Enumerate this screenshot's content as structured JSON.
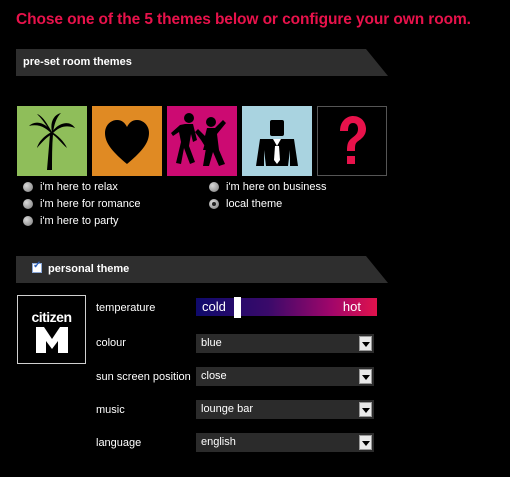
{
  "headline": "Chose one of the 5 themes below or configure your own room.",
  "preset_section": {
    "title": "pre-set room themes",
    "tiles": [
      {
        "name": "relax",
        "icon": "palm-tree-icon",
        "color": "#8fbe5a"
      },
      {
        "name": "romance",
        "icon": "heart-icon",
        "color": "#e08a23"
      },
      {
        "name": "party",
        "icon": "dancing-couple-icon",
        "color": "#cc0a72"
      },
      {
        "name": "business",
        "icon": "businessman-icon",
        "color": "#a9d3e0"
      },
      {
        "name": "local",
        "icon": "question-mark-icon",
        "color": "#000000"
      }
    ],
    "options": [
      {
        "label": "i'm here to relax",
        "checked": false
      },
      {
        "label": "i'm here for romance",
        "checked": false
      },
      {
        "label": "i'm here to party",
        "checked": false
      },
      {
        "label": "i'm here on business",
        "checked": false
      },
      {
        "label": "local theme",
        "checked": true
      }
    ]
  },
  "personal_section": {
    "title": "personal theme",
    "checked": true,
    "logo_text": "citizen",
    "temperature": {
      "label": "temperature",
      "cold_label": "cold",
      "hot_label": "hot",
      "value": 0.22
    },
    "fields": [
      {
        "label": "colour",
        "value": "blue"
      },
      {
        "label": "sun screen position",
        "value": "close"
      },
      {
        "label": "music",
        "value": "lounge bar"
      },
      {
        "label": "language",
        "value": "english"
      }
    ]
  },
  "colors": {
    "accent": "#e8124b",
    "bar": "#2e2e2e"
  }
}
